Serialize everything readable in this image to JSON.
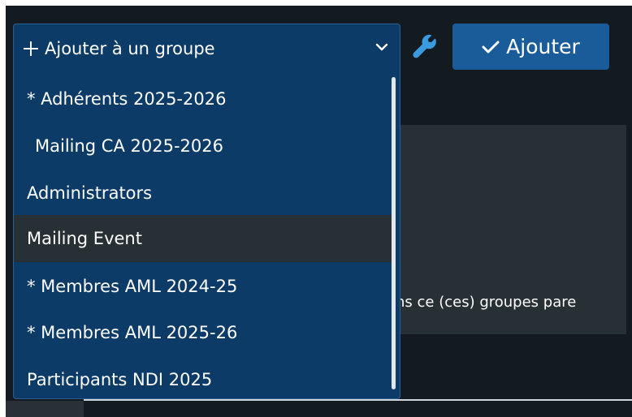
{
  "select": {
    "label": "Ajouter à un groupe"
  },
  "add_button": {
    "label": "Ajouter"
  },
  "dropdown": {
    "options": [
      {
        "label": "* Adhérents 2025-2026"
      },
      {
        "label": "Mailing CA 2025-2026"
      },
      {
        "label": "Administrators"
      },
      {
        "label": "Mailing Event"
      },
      {
        "label": "* Membres AML 2024-25"
      },
      {
        "label": "* Membres AML 2025-26"
      },
      {
        "label": "Participants NDI 2025"
      }
    ],
    "highlighted_index": 3
  },
  "background": {
    "partial_text": "ns ce (ces) groupes pare"
  },
  "colors": {
    "dropdown_bg": "#0d3b67",
    "button_bg": "#1a5c9a",
    "highlight_bg": "#273035",
    "wrench": "#3b9be0"
  }
}
